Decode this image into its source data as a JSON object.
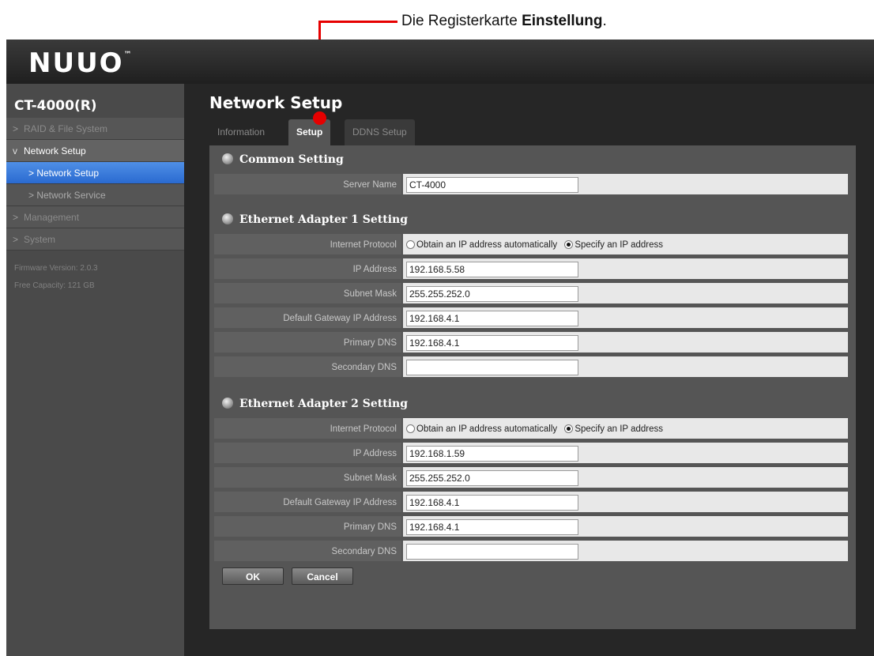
{
  "annotation": {
    "prefix": "Die Registerkarte ",
    "bold": "Einstellung",
    "suffix": "."
  },
  "app": {
    "logo": "NUUO",
    "logo_tm": "™"
  },
  "sidebar": {
    "device": "CT-4000(R)",
    "items": [
      {
        "label": "RAID & File System",
        "chev": ">"
      },
      {
        "label": "Network Setup",
        "chev": "v"
      },
      {
        "label": "> Network Setup"
      },
      {
        "label": "> Network Service"
      },
      {
        "label": "Management",
        "chev": ">"
      },
      {
        "label": "System",
        "chev": ">"
      }
    ],
    "firmware": "Firmware Version: 2.0.3",
    "capacity": "Free Capacity: 121 GB"
  },
  "main": {
    "title": "Network Setup",
    "tabs": [
      "Information",
      "Setup",
      "DDNS Setup"
    ],
    "common": {
      "title": "Common Setting",
      "server_name_label": "Server Name",
      "server_name_value": "CT-4000"
    },
    "adapter1": {
      "title": "Ethernet Adapter 1 Setting",
      "protocol_label": "Internet Protocol",
      "opt_auto": "Obtain an IP address automatically",
      "opt_manual": "Specify an IP address",
      "ip_label": "IP Address",
      "ip": "192.168.5.58",
      "mask_label": "Subnet Mask",
      "mask": "255.255.252.0",
      "gw_label": "Default Gateway IP Address",
      "gw": "192.168.4.1",
      "dns1_label": "Primary DNS",
      "dns1": "192.168.4.1",
      "dns2_label": "Secondary DNS",
      "dns2": ""
    },
    "adapter2": {
      "title": "Ethernet Adapter 2 Setting",
      "protocol_label": "Internet Protocol",
      "opt_auto": "Obtain an IP address automatically",
      "opt_manual": "Specify an IP address",
      "ip_label": "IP Address",
      "ip": "192.168.1.59",
      "mask_label": "Subnet Mask",
      "mask": "255.255.252.0",
      "gw_label": "Default Gateway IP Address",
      "gw": "192.168.4.1",
      "dns1_label": "Primary DNS",
      "dns1": "192.168.4.1",
      "dns2_label": "Secondary DNS",
      "dns2": ""
    },
    "buttons": {
      "ok": "OK",
      "cancel": "Cancel"
    }
  }
}
